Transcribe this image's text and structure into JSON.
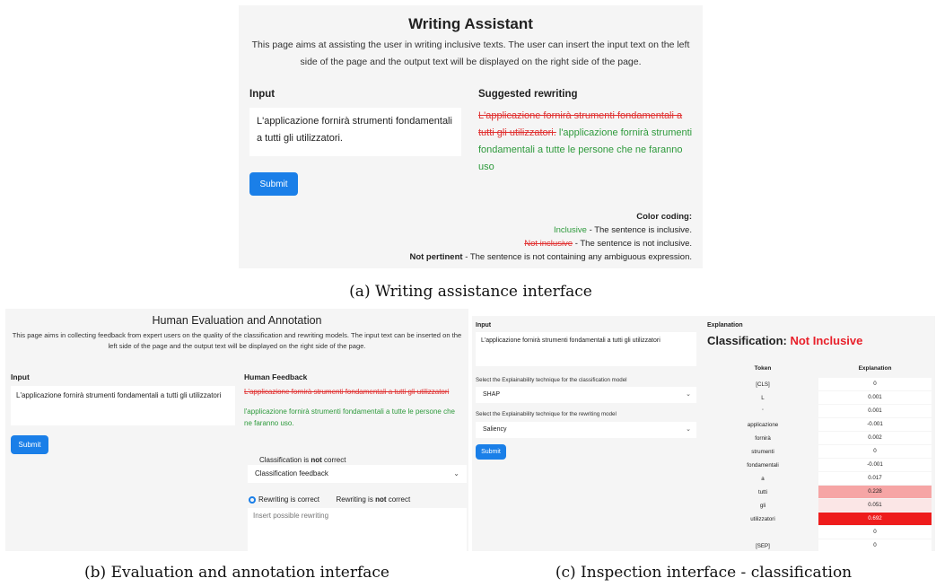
{
  "captions": {
    "a": "(a) Writing assistance interface",
    "b": "(b) Evaluation and annotation interface",
    "c": "(c) Inspection interface - classification"
  },
  "writing_assistant": {
    "title": "Writing Assistant",
    "description": "This page aims at assisting the user in writing inclusive texts. The user can insert the input text on the left side of the page and the output text will be displayed on the right side of the page.",
    "input_label": "Input",
    "input_text": "L'applicazione fornirà strumenti fondamentali a tutti gli utilizzatori.",
    "output_label": "Suggested rewriting",
    "output_struck": "L'applicazione fornirà strumenti fondamentali a tutti gli utilizzatori.",
    "output_suggested": "l'applicazione fornirà strumenti fondamentali a tutte le persone che ne faranno uso",
    "submit_label": "Submit",
    "legend": {
      "title": "Color coding:",
      "inclusive_term": "Inclusive",
      "inclusive_desc": " - The sentence is inclusive.",
      "not_inclusive_term": "Not inclusive",
      "not_inclusive_desc": " - The sentence is not inclusive.",
      "not_pertinent_term": "Not pertinent",
      "not_pertinent_desc": " - The sentence is not containing any ambiguous expression."
    }
  },
  "annotation": {
    "title": "Human Evaluation and Annotation",
    "description": "This page aims in collecting feedback from expert users on the quality of the classification and rewriting models. The input text can be inserted on the left side of the page and the output text will be displayed on the right side of the page.",
    "input_label": "Input",
    "input_text": "L'applicazione fornirà strumenti fondamentali a tutti gli utilizzatori",
    "submit_label": "Submit",
    "feedback_label": "Human Feedback",
    "output_struck": "L'applicazione fornirà strumenti fondamentali a tutti gli utilizzatori",
    "output_suggested": "l'applicazione fornirà strumenti fondamentali a tutte le persone che ne faranno uso.",
    "classification_prefix": "Classification is ",
    "classification_bold": "not",
    "classification_suffix": " correct",
    "classification_feedback": "Classification feedback",
    "radio_correct": "Rewriting is correct",
    "radio_incorrect_prefix": "Rewriting is ",
    "radio_incorrect_bold": "not",
    "radio_incorrect_suffix": " correct",
    "rewrite_placeholder": "Insert possible rewriting"
  },
  "inspection": {
    "input_label": "Input",
    "input_text": "L'applicazione fornirà strumenti fondamentali a tutti gli utilizzatori",
    "select1_label": "Select the Explainability technique for the classification model",
    "select1_value": "SHAP",
    "select2_label": "Select the Explainability technique for the rewriting model",
    "select2_value": "Saliency",
    "submit_label": "Submit",
    "explanation_label": "Explanation",
    "classification_prefix": "Classification: ",
    "classification_value": "Not Inclusive",
    "table": {
      "headers": [
        "Token",
        "Explanation"
      ],
      "rows": [
        {
          "token": "[CLS]",
          "value": "0",
          "highlight": "none"
        },
        {
          "token": "L",
          "value": "0.001",
          "highlight": "none"
        },
        {
          "token": "'",
          "value": "0.001",
          "highlight": "none"
        },
        {
          "token": "applicazione",
          "value": "-0.001",
          "highlight": "none"
        },
        {
          "token": "fornirà",
          "value": "0.002",
          "highlight": "none"
        },
        {
          "token": "strumenti",
          "value": "0",
          "highlight": "none"
        },
        {
          "token": "fondamentali",
          "value": "-0.001",
          "highlight": "none"
        },
        {
          "token": "a",
          "value": "0.017",
          "highlight": "none"
        },
        {
          "token": "tutti",
          "value": "0.228",
          "highlight": "light"
        },
        {
          "token": "gli",
          "value": "0.051",
          "highlight": "faint"
        },
        {
          "token": "utilizzatori",
          "value": "0.692",
          "highlight": "strong"
        },
        {
          "token": "",
          "value": "0",
          "highlight": "none"
        },
        {
          "token": "[SEP]",
          "value": "0",
          "highlight": "none"
        }
      ]
    }
  },
  "colors": {
    "primary": "#1a7fe8",
    "not_inclusive": "#e03030",
    "inclusive": "#2e9a3c",
    "highlight_strong": "#ee1c1c",
    "highlight_light": "#f6a5a5",
    "highlight_faint": "#fbe6e6"
  }
}
